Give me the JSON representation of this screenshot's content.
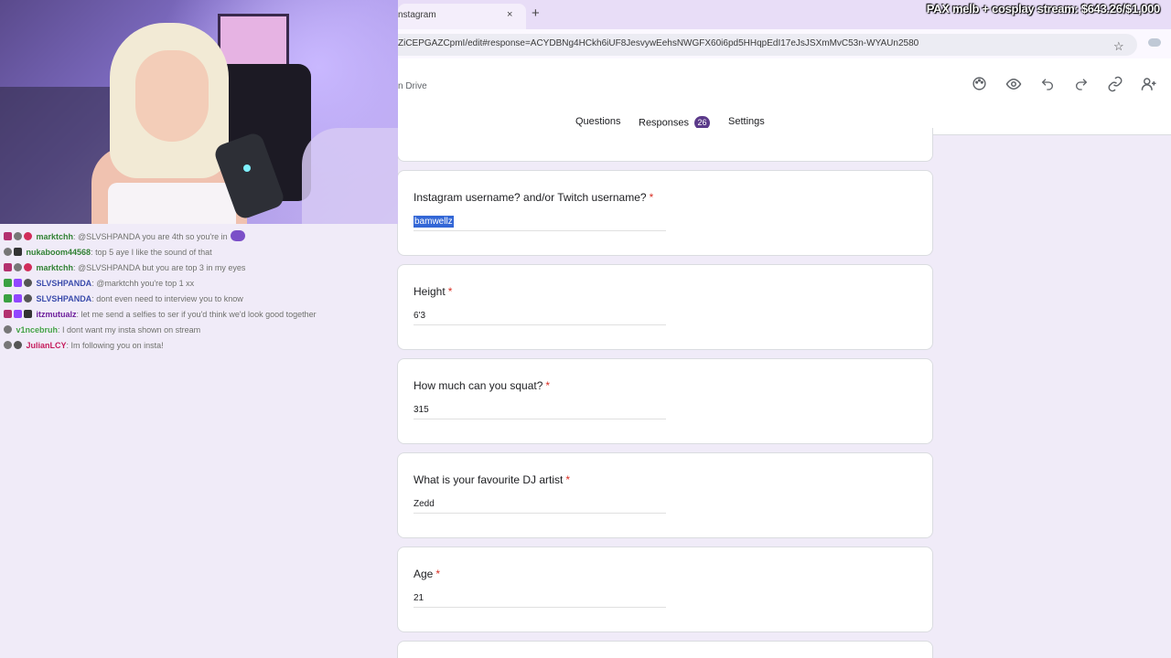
{
  "browser": {
    "tab_title": "nstagram",
    "tab_close": "×",
    "new_tab": "+",
    "url": "ZiCEPGAZCpmI/edit#response=ACYDBNg4HCkh6iUF8JesvywEehsNWGFX60i6pd5HHqpEdI17eJsJSXmMvC53n-WYAUn2580",
    "star_icon": "star-icon"
  },
  "overlay": {
    "goal_text": "PAX melb + cosplay stream: $643.26/$1,000"
  },
  "form_header": {
    "drive_text": "n Drive",
    "icons": [
      "palette-icon",
      "eye-icon",
      "undo-icon",
      "redo-icon",
      "link-icon",
      "add-person-icon"
    ],
    "tabs": {
      "questions": "Questions",
      "responses": "Responses",
      "responses_count": "26",
      "settings": "Settings"
    }
  },
  "questions": [
    {
      "q": "Instagram username? and/or Twitch username?",
      "required": "*",
      "a": "bamwellz"
    },
    {
      "q": "Height",
      "required": "*",
      "a": "6'3"
    },
    {
      "q": "How much can you squat?",
      "required": "*",
      "a": "315"
    },
    {
      "q": "What is your favourite DJ artist",
      "required": "*",
      "a": "Zedd"
    },
    {
      "q": "Age",
      "required": "*",
      "a": "21"
    }
  ],
  "chat": [
    {
      "user": "marktchh",
      "user_color": "#2e7d32",
      "msg": "@SLVSHPANDA you are 4th so you're in"
    },
    {
      "user": "nukaboom44568",
      "user_color": "#2e7d32",
      "msg": "top 5 aye I like the sound of that"
    },
    {
      "user": "marktchh",
      "user_color": "#2e7d32",
      "msg": "@SLVSHPANDA but you are top 3 in my eyes"
    },
    {
      "user": "SLVSHPANDA",
      "user_color": "#3949ab",
      "msg": "@marktchh you're top 1 xx"
    },
    {
      "user": "SLVSHPANDA",
      "user_color": "#3949ab",
      "msg": "dont even need to interview you to know"
    },
    {
      "user": "itzmutualz",
      "user_color": "#6a1b9a",
      "msg": "let me send a selfies to ser if you'd think we'd look good together"
    },
    {
      "user": "v1ncebruh",
      "user_color": "#43a047",
      "msg": "I dont want my insta shown on stream"
    },
    {
      "user": "JulianLCY",
      "user_color": "#c2185b",
      "msg": "Im following you on insta!"
    }
  ]
}
